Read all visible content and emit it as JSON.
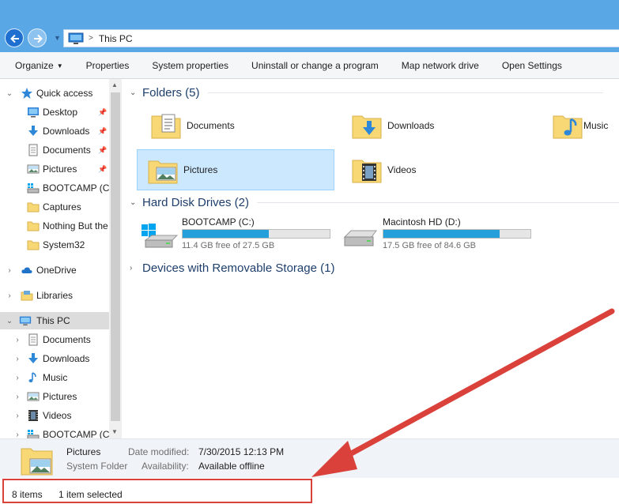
{
  "address": {
    "path": "This PC"
  },
  "toolbar": {
    "items": [
      {
        "label": "Organize",
        "dropdown": true
      },
      {
        "label": "Properties"
      },
      {
        "label": "System properties"
      },
      {
        "label": "Uninstall or change a program"
      },
      {
        "label": "Map network drive"
      },
      {
        "label": "Open Settings"
      }
    ]
  },
  "sidebar": {
    "quick_access": "Quick access",
    "quick_items": [
      {
        "label": "Desktop",
        "icon": "desktop-icon",
        "pinned": true
      },
      {
        "label": "Downloads",
        "icon": "download-arrow-icon",
        "pinned": true
      },
      {
        "label": "Documents",
        "icon": "document-icon",
        "pinned": true
      },
      {
        "label": "Pictures",
        "icon": "pictures-icon",
        "pinned": true
      },
      {
        "label": "BOOTCAMP (C:)",
        "icon": "drive-icon"
      },
      {
        "label": "Captures",
        "icon": "folder-icon"
      },
      {
        "label": "Nothing But the",
        "icon": "folder-icon"
      },
      {
        "label": "System32",
        "icon": "folder-icon"
      }
    ],
    "onedrive": "OneDrive",
    "libraries": "Libraries",
    "this_pc": "This PC",
    "pc_items": [
      {
        "label": "Documents",
        "icon": "document-icon"
      },
      {
        "label": "Downloads",
        "icon": "download-arrow-icon"
      },
      {
        "label": "Music",
        "icon": "music-note-icon"
      },
      {
        "label": "Pictures",
        "icon": "pictures-icon"
      },
      {
        "label": "Videos",
        "icon": "film-icon"
      },
      {
        "label": "BOOTCAMP (C:",
        "icon": "drive-icon"
      }
    ]
  },
  "content": {
    "folders_header": "Folders (5)",
    "folders": [
      {
        "label": "Documents",
        "icon": "documents-folder-icon"
      },
      {
        "label": "Downloads",
        "icon": "downloads-folder-icon"
      },
      {
        "label": "Music",
        "icon": "music-folder-icon"
      },
      {
        "label": "Pictures",
        "icon": "pictures-folder-icon",
        "selected": true
      },
      {
        "label": "Videos",
        "icon": "videos-folder-icon"
      }
    ],
    "drives_header": "Hard Disk Drives (2)",
    "drives": [
      {
        "label": "BOOTCAMP (C:)",
        "free": "11.4 GB free of 27.5 GB",
        "used_fraction": 0.585
      },
      {
        "label": "Macintosh HD (D:)",
        "free": "17.5 GB free of 84.6 GB",
        "used_fraction": 0.793
      }
    ],
    "removable_header": "Devices with Removable Storage (1)"
  },
  "details": {
    "name": "Pictures",
    "type": "System Folder",
    "modified_label": "Date modified:",
    "modified_value": "7/30/2015 12:13 PM",
    "availability_label": "Availability:",
    "availability_value": "Available offline"
  },
  "status": {
    "items_count": "8 items",
    "selected": "1 item selected"
  },
  "colors": {
    "accent": "#5aa7e6",
    "selection": "#cce8ff",
    "drive_bar": "#26a0da",
    "annotation": "#d9413a"
  }
}
